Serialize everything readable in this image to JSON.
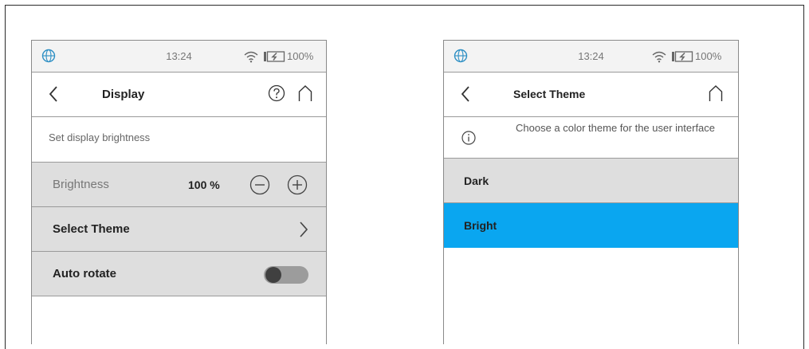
{
  "colors": {
    "accent": "#0aa6f0",
    "row_bg": "#dedede",
    "status_bg": "#f3f3f3",
    "border": "#9a9a9a"
  },
  "left_screen": {
    "status": {
      "time": "13:24",
      "battery": "100%",
      "icons": [
        "globe-icon",
        "wifi-icon",
        "battery-charging-icon"
      ]
    },
    "header": {
      "title": "Display",
      "icons": [
        "back-icon",
        "help-icon",
        "home-icon"
      ]
    },
    "description": "Set display brightness",
    "brightness": {
      "label": "Brightness",
      "value": "100 %",
      "icons": [
        "minus-icon",
        "plus-icon"
      ]
    },
    "select_theme": {
      "label": "Select Theme",
      "icon": "chevron-right-icon"
    },
    "auto_rotate": {
      "label": "Auto rotate",
      "enabled": false
    }
  },
  "right_screen": {
    "status": {
      "time": "13:24",
      "battery": "100%",
      "icons": [
        "globe-icon",
        "wifi-icon",
        "battery-charging-icon"
      ]
    },
    "header": {
      "title": "Select Theme",
      "icons": [
        "back-icon",
        "home-icon"
      ]
    },
    "info": {
      "text": "Choose a color theme for the user interface",
      "icon": "info-icon"
    },
    "themes": [
      {
        "label": "Dark",
        "selected": false
      },
      {
        "label": "Bright",
        "selected": true
      }
    ]
  }
}
